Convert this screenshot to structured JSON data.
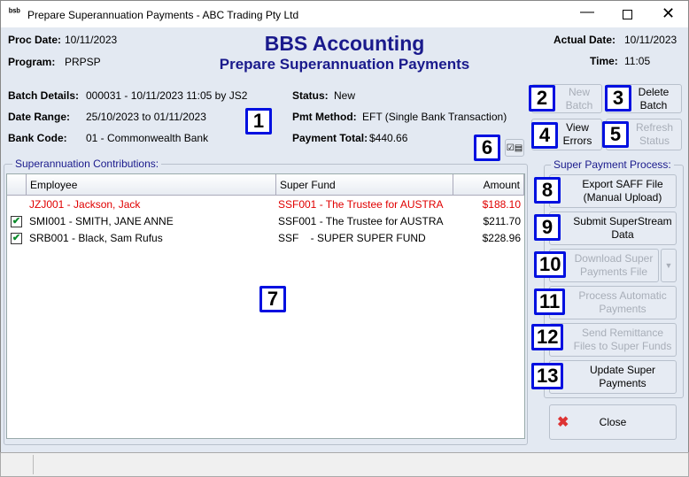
{
  "window": {
    "title": "Prepare Superannuation Payments - ABC Trading Pty Ltd",
    "app_icon": "bbs-logo-icon"
  },
  "header": {
    "proc_date_label": "Proc Date:",
    "proc_date": "10/11/2023",
    "program_label": "Program:",
    "program": "PRPSP",
    "title": "BBS Accounting",
    "subtitle": "Prepare Superannuation Payments",
    "actual_date_label": "Actual Date:",
    "actual_date": "10/11/2023",
    "time_label": "Time:",
    "time": "11:05"
  },
  "batch": {
    "details_label": "Batch Details:",
    "details": "000031 - 10/11/2023 11:05 by JS2",
    "range_label": "Date Range:",
    "range": "25/10/2023 to 01/11/2023",
    "bank_label": "Bank Code:",
    "bank": "01 - Commonwealth Bank",
    "status_label": "Status:",
    "status": "New",
    "method_label": "Pmt Method:",
    "method": "EFT (Single Bank Transaction)",
    "total_label": "Payment Total:",
    "total": "$440.66"
  },
  "badges": [
    "1",
    "2",
    "3",
    "4",
    "5",
    "6",
    "7",
    "8",
    "9",
    "10",
    "11",
    "12",
    "13"
  ],
  "buttons": {
    "new_batch": "New\nBatch",
    "delete_batch": "Delete\nBatch",
    "view_errors": "View\nErrors",
    "refresh_status": "Refresh\nStatus",
    "close": "Close"
  },
  "contributions": {
    "title": "Superannuation Contributions:",
    "columns": [
      "Employee",
      "Super Fund",
      "Amount"
    ],
    "rows": [
      {
        "checked": false,
        "employee": "JZJ001 - Jackson, Jack",
        "fund": "SSF001 - The Trustee for AUSTRA",
        "amount": "$188.10",
        "error": true
      },
      {
        "checked": true,
        "employee": "SMI001 - SMITH, JANE ANNE",
        "fund": "SSF001 - The Trustee for AUSTRA",
        "amount": "$211.70",
        "error": false
      },
      {
        "checked": true,
        "employee": "SRB001 - Black, Sam Rufus",
        "fund": "SSF    - SUPER SUPER FUND",
        "amount": "$228.96",
        "error": false
      }
    ]
  },
  "process": {
    "title": "Super Payment Process:",
    "export_saff": "Export SAFF File\n(Manual Upload)",
    "submit_superstream": "Submit SuperStream\nData",
    "download_file": "Download Super\nPayments File",
    "process_auto": "Process Automatic\nPayments",
    "send_remittance": "Send Remittance\nFiles to Super Funds",
    "update_super": "Update Super\nPayments"
  },
  "colors": {
    "title": "#1a1a8c",
    "error": "#e00000",
    "badge_border": "#0010e0"
  }
}
